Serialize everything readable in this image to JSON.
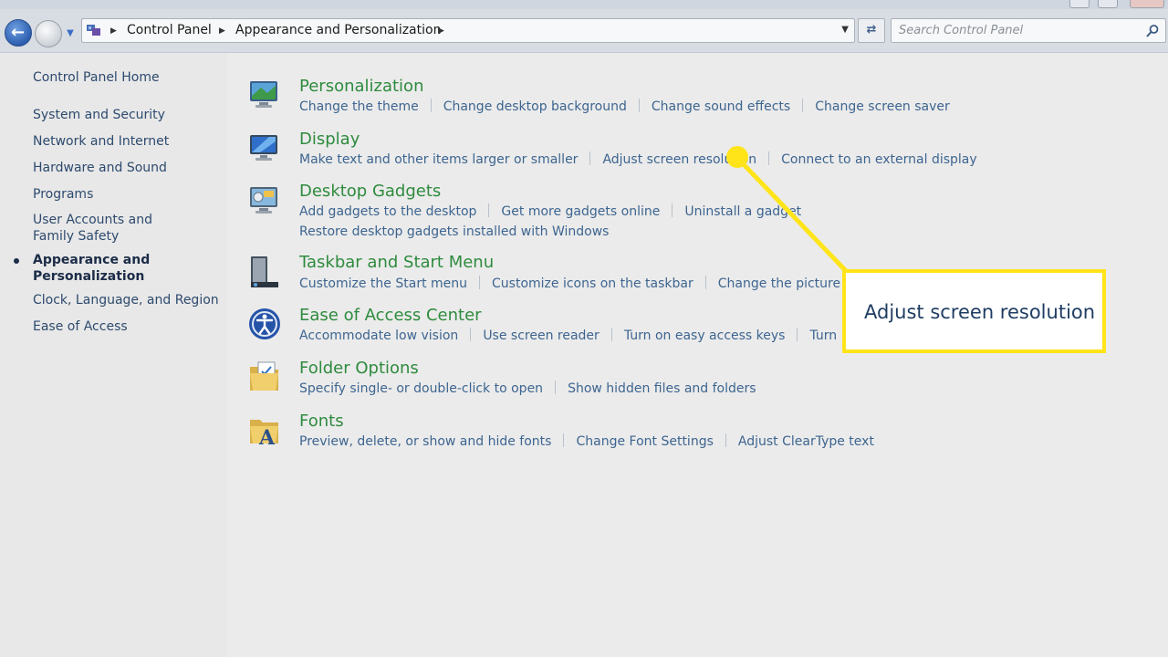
{
  "address_bar": {
    "breadcrumbs": [
      "Control Panel",
      "Appearance and Personalization"
    ]
  },
  "search": {
    "placeholder": "Search Control Panel"
  },
  "sidebar": {
    "home": "Control Panel Home",
    "items": [
      {
        "label": "System and Security"
      },
      {
        "label": "Network and Internet"
      },
      {
        "label": "Hardware and Sound"
      },
      {
        "label": "Programs"
      },
      {
        "label": "User Accounts and Family Safety"
      },
      {
        "label": "Appearance and Personalization",
        "current": true
      },
      {
        "label": "Clock, Language, and Region"
      },
      {
        "label": "Ease of Access"
      }
    ]
  },
  "categories": [
    {
      "title": "Personalization",
      "icon": "personalization-icon",
      "links": [
        "Change the theme",
        "Change desktop background",
        "Change sound effects",
        "Change screen saver"
      ]
    },
    {
      "title": "Display",
      "icon": "display-icon",
      "links": [
        "Make text and other items larger or smaller",
        "Adjust screen resolution",
        "Connect to an external display"
      ]
    },
    {
      "title": "Desktop Gadgets",
      "icon": "gadgets-icon",
      "links": [
        "Add gadgets to the desktop",
        "Get more gadgets online",
        "Uninstall a gadget"
      ],
      "links2": [
        "Restore desktop gadgets installed with Windows"
      ]
    },
    {
      "title": "Taskbar and Start Menu",
      "icon": "taskbar-icon",
      "links": [
        "Customize the Start menu",
        "Customize icons on the taskbar",
        "Change the picture on th"
      ]
    },
    {
      "title": "Ease of Access Center",
      "icon": "ease-of-access-icon",
      "links": [
        "Accommodate low vision",
        "Use screen reader",
        "Turn on easy access keys",
        "Turn High"
      ]
    },
    {
      "title": "Folder Options",
      "icon": "folder-options-icon",
      "links": [
        "Specify single- or double-click to open",
        "Show hidden files and folders"
      ]
    },
    {
      "title": "Fonts",
      "icon": "fonts-icon",
      "links": [
        "Preview, delete, or show and hide fonts",
        "Change Font Settings",
        "Adjust ClearType text"
      ]
    }
  ],
  "callout": {
    "text": "Adjust screen resolution",
    "color": "#ffe419"
  },
  "colors": {
    "category_title": "#2e8b3e",
    "link": "#3d6590",
    "sidebar_link": "#2d4a6e"
  }
}
